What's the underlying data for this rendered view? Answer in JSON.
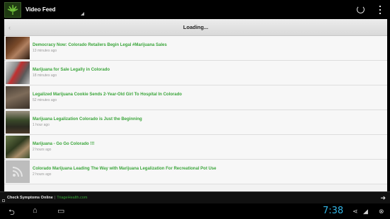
{
  "app": {
    "title": "Video Feed",
    "icon": "cannabis-leaf-icon"
  },
  "toolbar": {
    "refresh_icon": "refresh-icon",
    "menu_icon": "overflow-menu-icon"
  },
  "loading": {
    "text": "Loading..."
  },
  "feed": [
    {
      "title": "Democracy Now: Colorado Retailers Begin Legal #Marijuana Sales",
      "time": "13 minutes ago",
      "thumb": "video-thumbnail"
    },
    {
      "title": "Marijuana for Sale Legally in Colorado",
      "time": "18 minutes ago",
      "thumb": "video-thumbnail"
    },
    {
      "title": "Legalized Marijuana Cookie Sends 2-Year-Old Girl To Hospital In Colorado",
      "time": "52 minutes ago",
      "thumb": "video-thumbnail"
    },
    {
      "title": "Marijuana Legalization Colorado is Just the Beginning",
      "time": "1 hour ago",
      "thumb": "video-thumbnail"
    },
    {
      "title": "Marijuana - Go Go Colorado !!!",
      "time": "2 hours ago",
      "thumb": "video-thumbnail"
    },
    {
      "title": "Colorado Marijuana Leading The Way with Marijuana Legalization For Recreational Pot Use",
      "time": "2 hours ago",
      "thumb": "rss-icon"
    }
  ],
  "ad": {
    "label": "Check Symptoms Online",
    "separator": "|",
    "site": "TriageHealth.com"
  },
  "system": {
    "clock": "7:38",
    "accent_color": "#33b5e5"
  },
  "colors": {
    "title_green": "#3aa53a",
    "time_gray": "#9a9a9a"
  }
}
